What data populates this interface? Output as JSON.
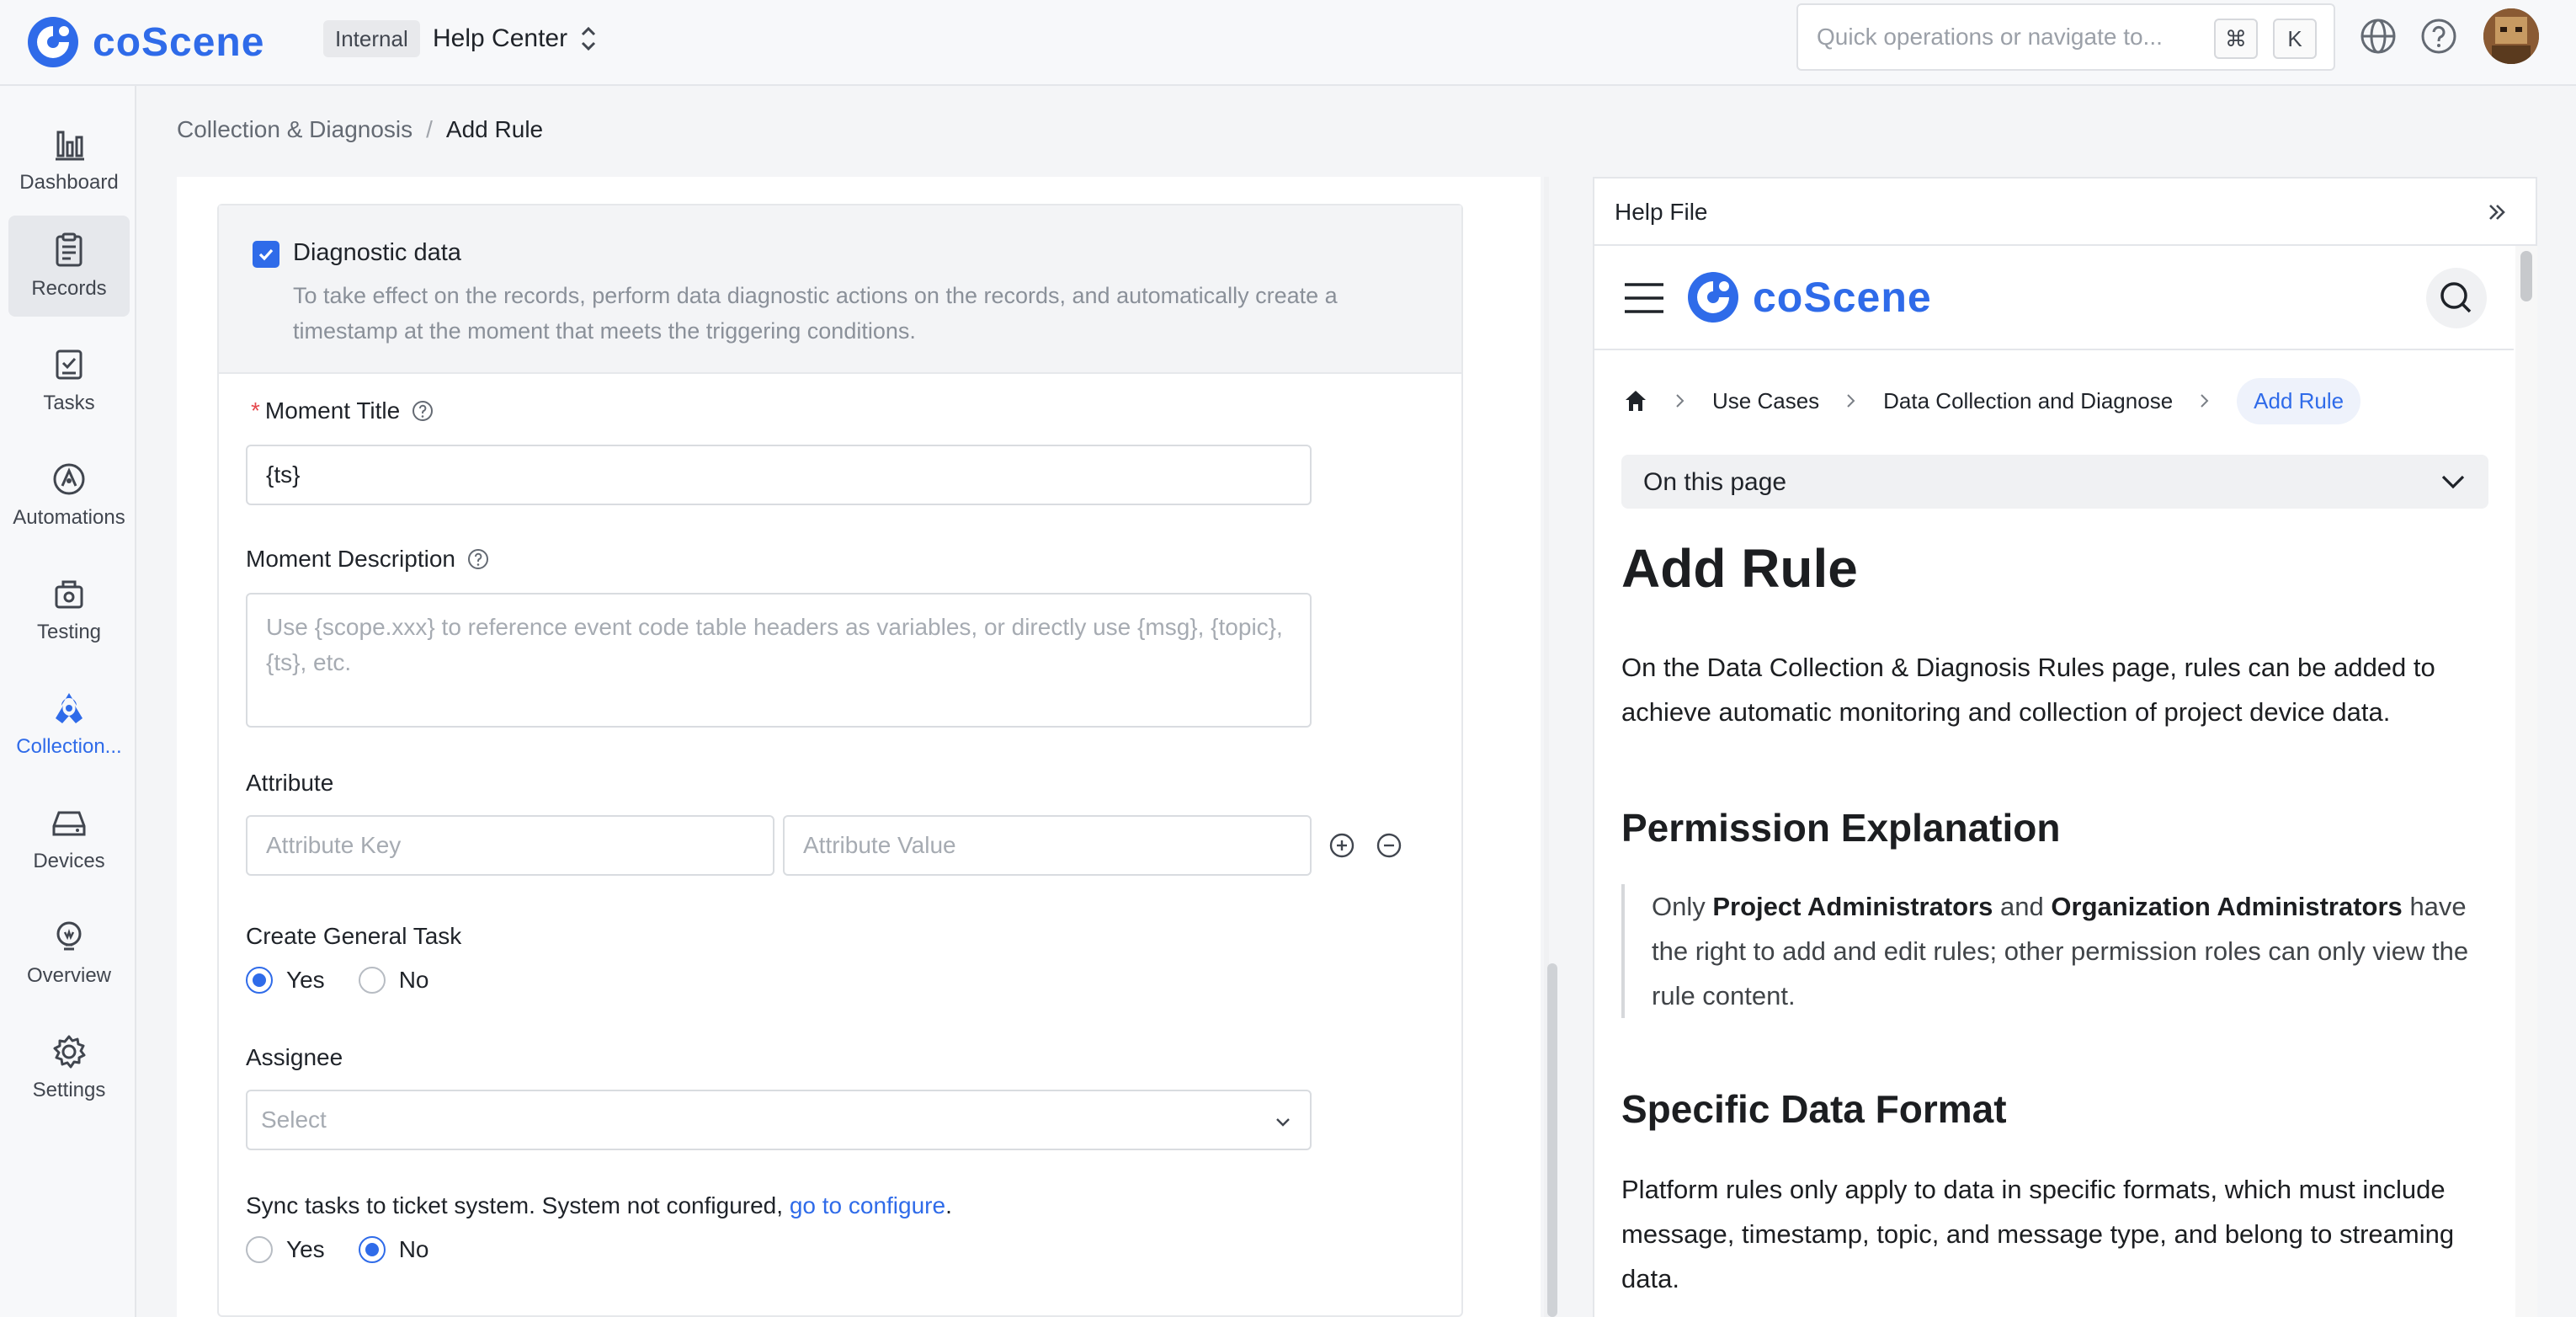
{
  "topbar": {
    "brand": "coScene",
    "org_badge": "Internal",
    "project": "Help Center",
    "search_placeholder": "Quick operations or navigate to...",
    "kbd_cmd": "⌘",
    "kbd_key": "K"
  },
  "nav": {
    "dashboard": "Dashboard",
    "records": "Records",
    "tasks": "Tasks",
    "automations": "Automations",
    "testing": "Testing",
    "collection": "Collection...",
    "devices": "Devices",
    "overview": "Overview",
    "settings": "Settings"
  },
  "breadcrumb": {
    "parent": "Collection & Diagnosis",
    "separator": "/",
    "current": "Add Rule"
  },
  "form": {
    "diagnostic_title": "Diagnostic data",
    "diagnostic_desc": "To take effect on the records, perform data diagnostic actions on the records, and automatically create a timestamp at the moment that meets the triggering conditions.",
    "moment_title_label": "Moment Title",
    "moment_title_value": "{ts}",
    "moment_desc_label": "Moment Description",
    "moment_desc_placeholder": "Use {scope.xxx} to reference event code table headers as variables, or directly use {msg}, {topic}, {ts}, etc.",
    "attribute_label": "Attribute",
    "attribute_key_placeholder": "Attribute Key",
    "attribute_value_placeholder": "Attribute Value",
    "general_task_label": "Create General Task",
    "yes": "Yes",
    "no": "No",
    "assignee_label": "Assignee",
    "assignee_placeholder": "Select",
    "sync_text": "Sync tasks to ticket system. System not configured,",
    "sync_link": "go to configure",
    "sync_period": "."
  },
  "help": {
    "title": "Help File",
    "brand": "coScene",
    "crumb_use_cases": "Use Cases",
    "crumb_data": "Data Collection and Diagnose",
    "crumb_current": "Add Rule",
    "toc": "On this page",
    "h1": "Add Rule",
    "intro": "On the Data Collection & Diagnosis Rules page, rules can be added to achieve automatic monitoring and collection of project device data.",
    "h2_permission": "Permission Explanation",
    "quote_only": "Only",
    "quote_proj_admin": "Project Administrators",
    "quote_and": "and",
    "quote_org_admin": "Organization Administrators",
    "quote_rest": "have the right to add and edit rules; other permission roles can only view the rule content.",
    "h2_format": "Specific Data Format",
    "format_text": "Platform rules only apply to data in specific formats, which must include message, timestamp, topic, and message type, and belong to streaming data."
  },
  "colors": {
    "accent": "#2f6be9",
    "required": "#e5484d"
  }
}
